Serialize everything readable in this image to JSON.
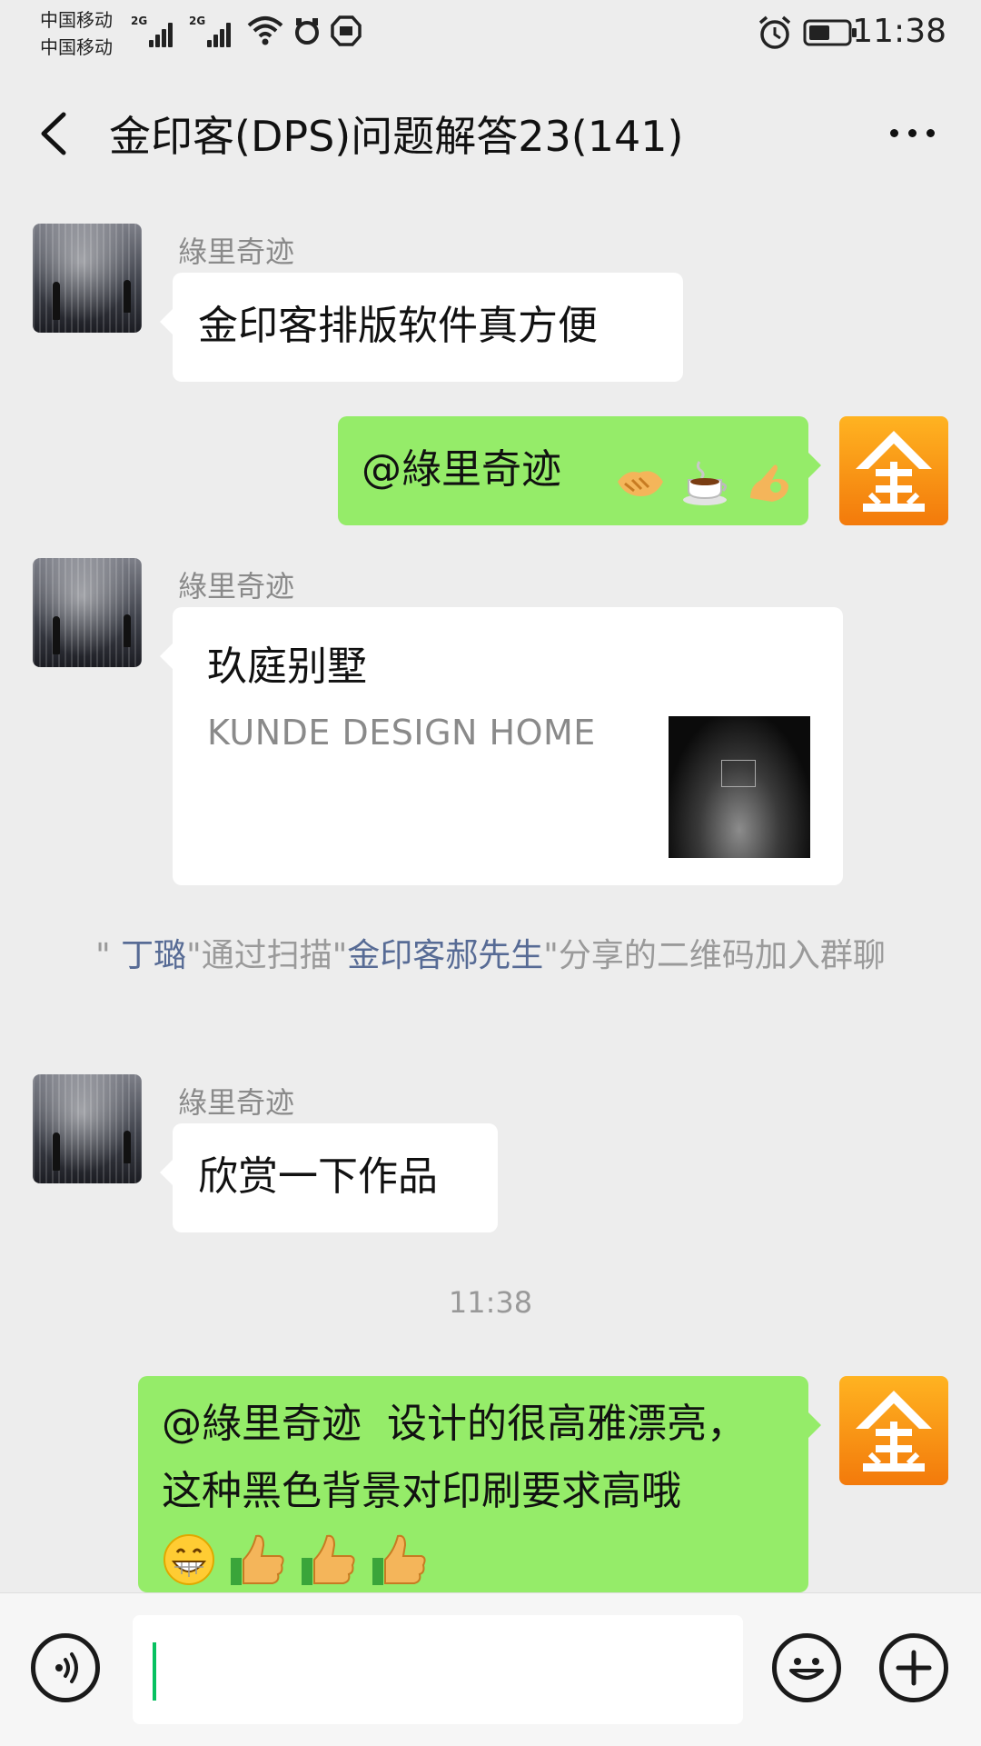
{
  "status_bar": {
    "carrier1": "中国移动",
    "carrier2": "中国移动",
    "network1": "2G",
    "network2": "2G",
    "time": "11:38",
    "icons": [
      "wifi-icon",
      "alarm-icon",
      "battery-icon"
    ]
  },
  "header": {
    "title": "金印客(DPS)问题解答23(141)",
    "back_icon": "chevron-left-icon",
    "more_icon": "more-dots-icon"
  },
  "messages": [
    {
      "type": "text",
      "side": "left",
      "sender": "綠里奇迹",
      "text": "金印客排版软件真方便"
    },
    {
      "type": "text",
      "side": "right",
      "text": "@綠里奇迹 ",
      "emojis": [
        "handshake-emoji",
        "coffee-emoji",
        "ok-hand-emoji"
      ]
    },
    {
      "type": "link",
      "side": "left",
      "sender": "綠里奇迹",
      "title": "玖庭别墅",
      "description": "KUNDE DESIGN HOME"
    },
    {
      "type": "system",
      "parts": [
        "\"",
        " 丁璐",
        "\"通过扫描\"",
        "金印客郝先生",
        "\"分享的二维码加入群聊"
      ]
    },
    {
      "type": "text",
      "side": "left",
      "sender": "綠里奇迹",
      "text": "欣赏一下作品"
    },
    {
      "type": "time",
      "text": "11:38"
    },
    {
      "type": "text",
      "side": "right",
      "lines": [
        "@綠里奇迹  设计的很高雅漂亮，",
        "这种黑色背景对印刷要求高哦"
      ],
      "emojis": [
        "grin-emoji",
        "thumbs-up-emoji",
        "thumbs-up-emoji",
        "thumbs-up-emoji"
      ]
    }
  ],
  "input_bar": {
    "voice_icon": "voice-icon",
    "emoji_icon": "smiley-icon",
    "plus_icon": "plus-icon",
    "input_value": ""
  },
  "colors": {
    "background": "#ededed",
    "bubble_self": "#95ec69",
    "bubble_other": "#ffffff",
    "link_name": "#576b95",
    "cursor": "#07c160",
    "logo_orange": "#f58a12"
  }
}
